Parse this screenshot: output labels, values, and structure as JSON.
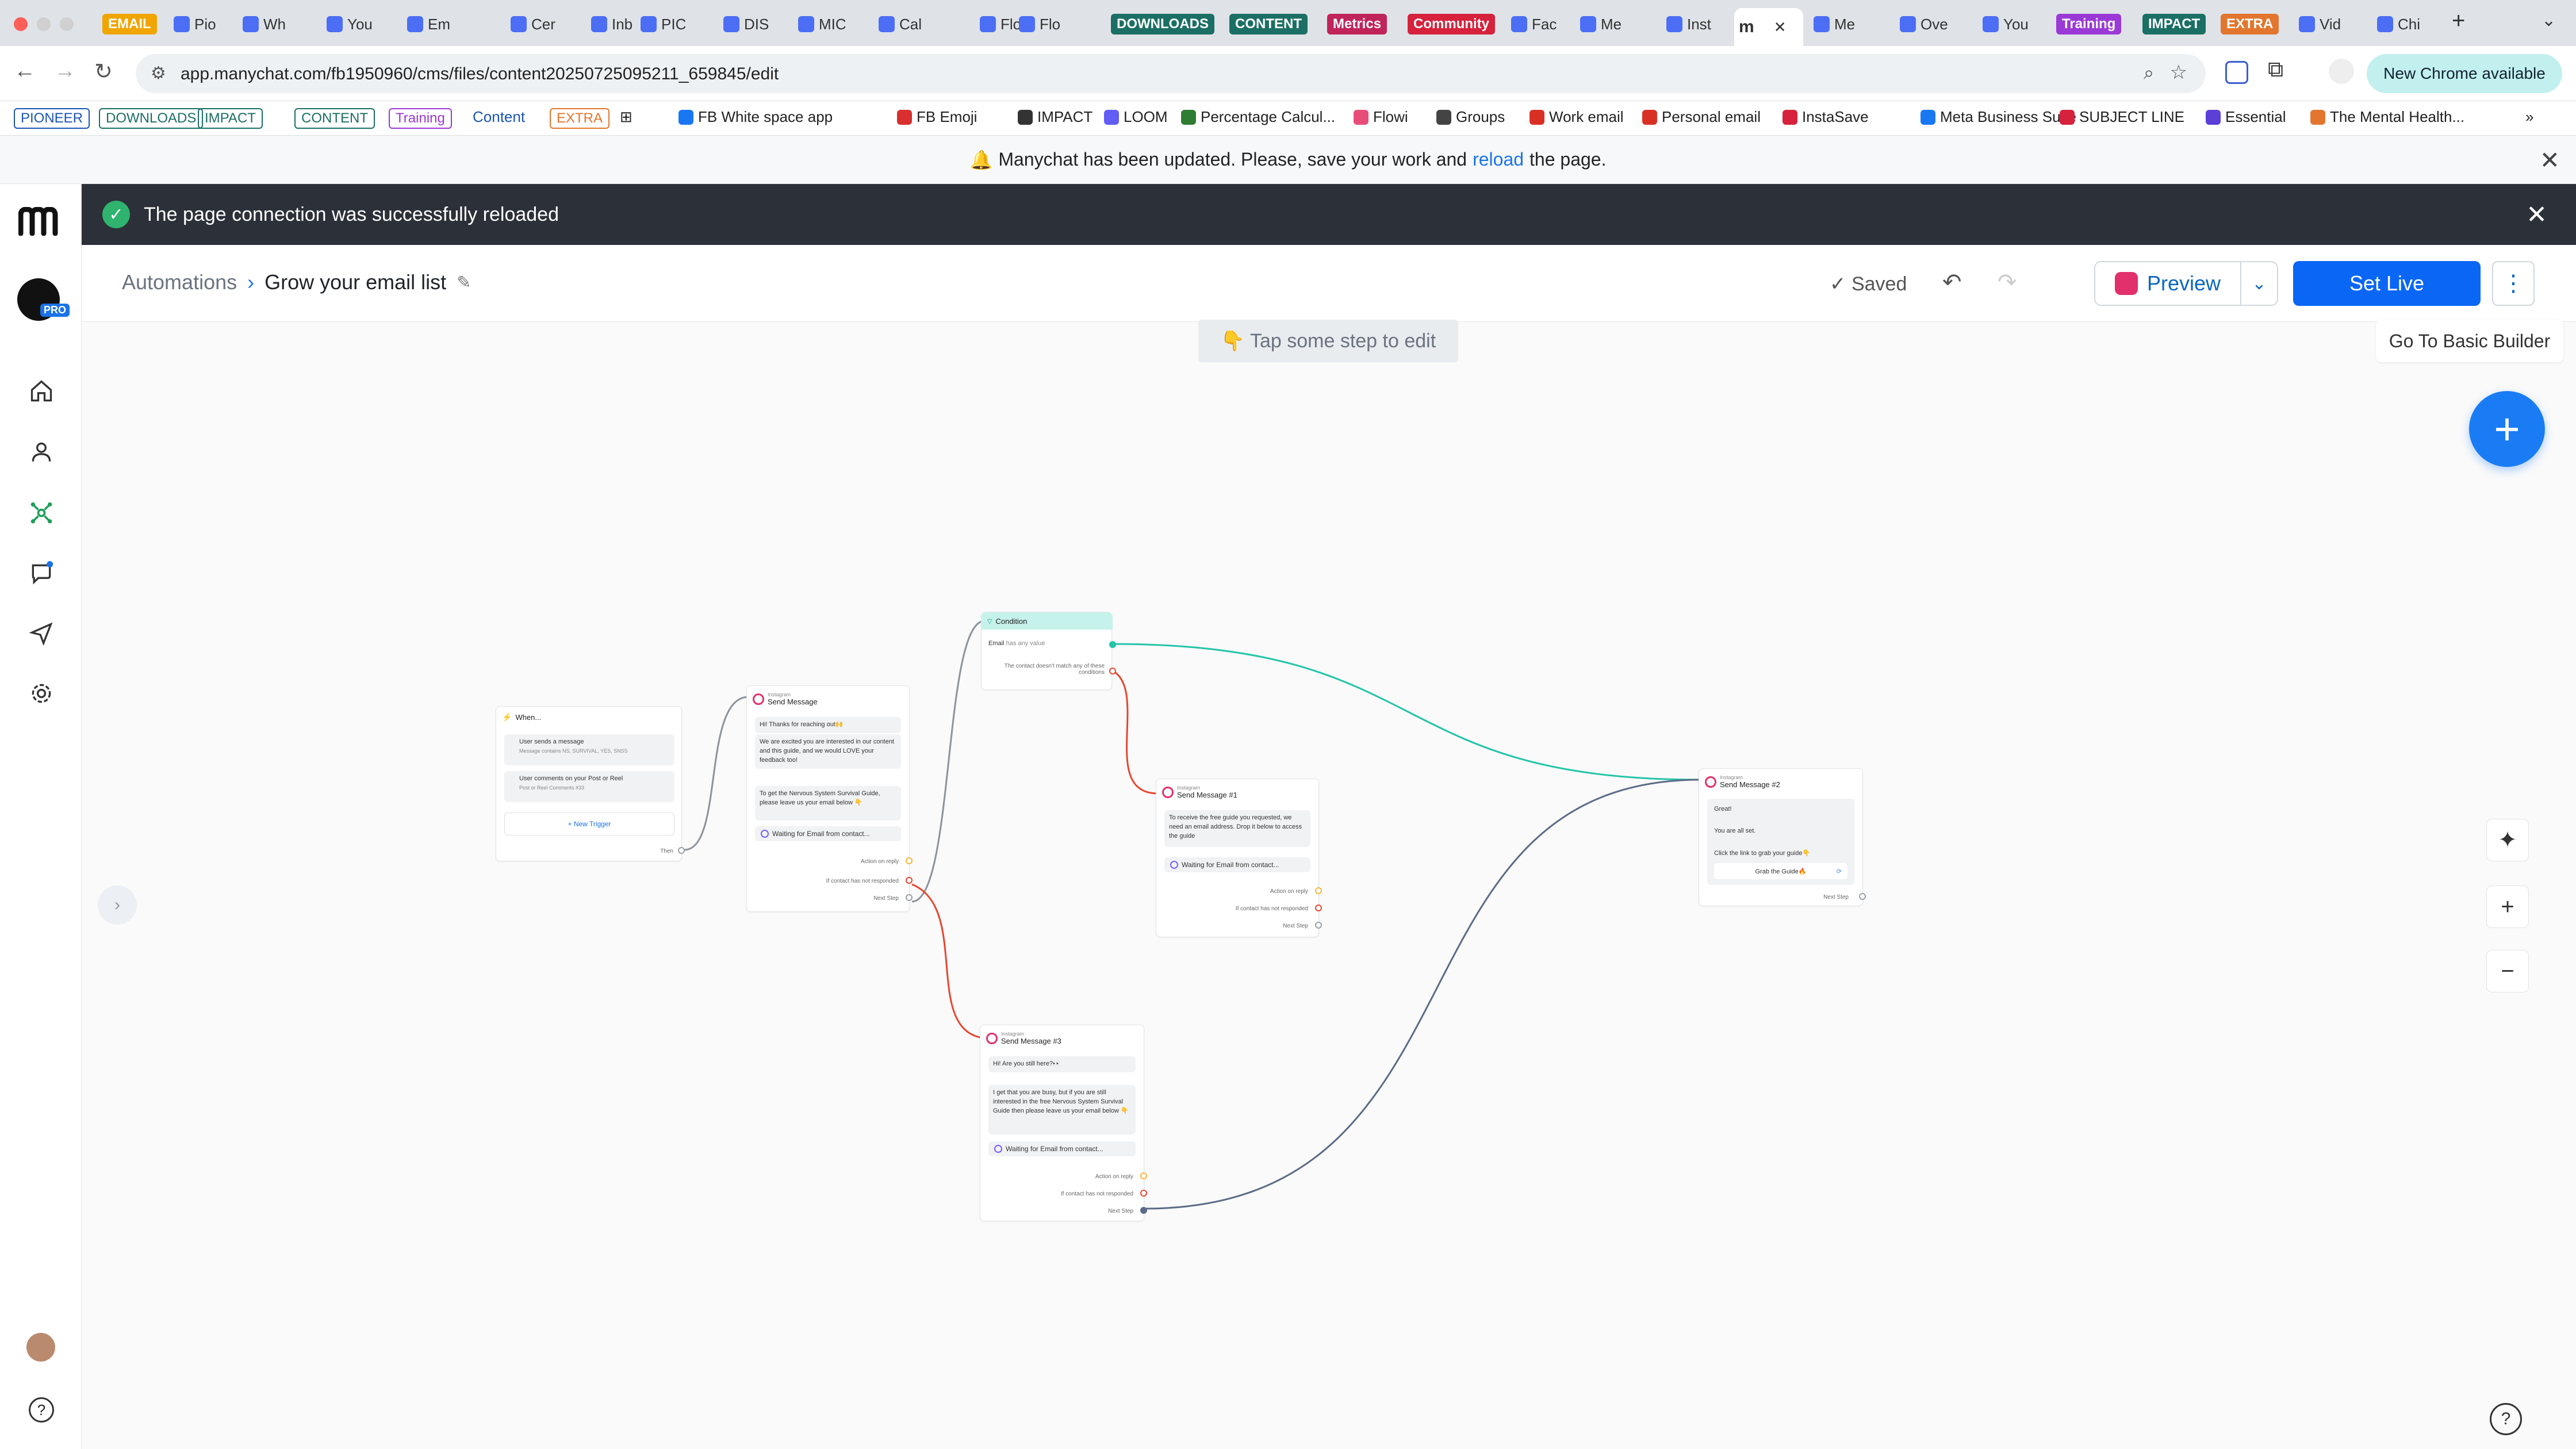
{
  "browser": {
    "tabs": [
      {
        "label": "EMAIL",
        "kind": "pill",
        "color": "#f0a500"
      },
      {
        "label": "Pio",
        "kind": "tab"
      },
      {
        "label": "Wh",
        "kind": "tab"
      },
      {
        "label": "You",
        "kind": "tab"
      },
      {
        "label": "Em",
        "kind": "tab"
      },
      {
        "label": "Cer",
        "kind": "tab"
      },
      {
        "label": "Inb",
        "kind": "tab"
      },
      {
        "label": "PIC",
        "kind": "tab"
      },
      {
        "label": "DIS",
        "kind": "tab"
      },
      {
        "label": "MIC",
        "kind": "tab"
      },
      {
        "label": "Cal",
        "kind": "tab"
      },
      {
        "label": "Flo",
        "kind": "tab"
      },
      {
        "label": "Flo",
        "kind": "tab"
      },
      {
        "label": "DOWNLOADS",
        "kind": "pill",
        "color": "#1b6f64"
      },
      {
        "label": "CONTENT",
        "kind": "pill",
        "color": "#1b6f64"
      },
      {
        "label": "Metrics",
        "kind": "pill",
        "color": "#c0245a"
      },
      {
        "label": "Community",
        "kind": "pill",
        "color": "#d6223c"
      },
      {
        "label": "Fac",
        "kind": "tab"
      },
      {
        "label": "Me",
        "kind": "tab"
      },
      {
        "label": "Inst",
        "kind": "tab"
      },
      {
        "label": "",
        "kind": "active"
      },
      {
        "label": "Me",
        "kind": "tab"
      },
      {
        "label": "Ove",
        "kind": "tab"
      },
      {
        "label": "You",
        "kind": "tab"
      },
      {
        "label": "Training",
        "kind": "pill",
        "color": "#9b39d6"
      },
      {
        "label": "IMPACT",
        "kind": "pill",
        "color": "#1b6f64"
      },
      {
        "label": "EXTRA",
        "kind": "pill",
        "color": "#e2762e"
      },
      {
        "label": "Vid",
        "kind": "tab"
      },
      {
        "label": "Chi",
        "kind": "tab"
      }
    ],
    "url": "app.manychat.com/fb1950960/cms/files/content20250725095211_659845/edit",
    "new_chrome": "New Chrome available",
    "bookmarks": [
      {
        "label": "PIONEER",
        "kind": "pill",
        "color": "#1a55b8"
      },
      {
        "label": "DOWNLOADS",
        "kind": "pill",
        "color": "#1b6f64"
      },
      {
        "label": "IMPACT",
        "kind": "pill",
        "color": "#1b6f64"
      },
      {
        "label": "CONTENT",
        "kind": "pill",
        "color": "#1b6f64"
      },
      {
        "label": "Training",
        "kind": "pill",
        "color": "#9b39d6"
      },
      {
        "label": "Content",
        "kind": "text",
        "color": "#1a55b8"
      },
      {
        "label": "EXTRA",
        "kind": "pill",
        "color": "#e2762e"
      },
      {
        "label": "FB White space app",
        "kind": "link",
        "color": "#1877f2"
      },
      {
        "label": "FB Emoji",
        "kind": "link",
        "color": "#d92f2f"
      },
      {
        "label": "IMPACT",
        "kind": "link",
        "color": "#333333"
      },
      {
        "label": "LOOM",
        "kind": "link",
        "color": "#625df5"
      },
      {
        "label": "Percentage Calcul...",
        "kind": "link",
        "color": "#2e7d32"
      },
      {
        "label": "Flowi",
        "kind": "link",
        "color": "#e84d7a"
      },
      {
        "label": "Groups",
        "kind": "link",
        "color": "#444444"
      },
      {
        "label": "Work email",
        "kind": "link",
        "color": "#d93025"
      },
      {
        "label": "Personal email",
        "kind": "link",
        "color": "#d93025"
      },
      {
        "label": "InstaSave",
        "kind": "link",
        "color": "#d6223c"
      },
      {
        "label": "Meta Business Suite",
        "kind": "link",
        "color": "#1877f2"
      },
      {
        "label": "SUBJECT LINE",
        "kind": "link",
        "color": "#d6223c"
      },
      {
        "label": "Essential",
        "kind": "link",
        "color": "#5b3fd6"
      },
      {
        "label": "The Mental Health...",
        "kind": "link",
        "color": "#e2762e"
      }
    ]
  },
  "update_banner": {
    "before": "Manychat has been updated. Please, save your work and",
    "link": "reload",
    "after": "the page."
  },
  "success_banner": "The page connection was successfully reloaded",
  "header": {
    "crumb_root": "Automations",
    "crumb_current": "Grow your email list",
    "saved": "Saved",
    "preview": "Preview",
    "set_live": "Set Live"
  },
  "canvas": {
    "tap_hint": "👇 Tap some step to edit",
    "basic_builder": "Go To Basic Builder"
  },
  "colors": {
    "brand_blue": "#0a66f5",
    "success_green": "#2fb36f",
    "edge_green": "#24c4a8",
    "edge_red": "#e8452f",
    "edge_blue": "#5b6b88",
    "edge_gray": "#8c939c",
    "instagram": "#e1306c"
  },
  "nodes": {
    "trigger": {
      "title": "When...",
      "trigger1": "User sends a message",
      "trigger1_sub": "Message contains NS, SURVIVAL, YES, SNSS",
      "trigger2": "User comments on your Post or Reel",
      "trigger2_sub": "Post or Reel Comments #33",
      "new_trigger": "+ New Trigger",
      "then": "Then"
    },
    "msg1": {
      "platform": "Instagram",
      "title": "Send Message",
      "b1": "Hi! Thanks for reaching out🙌",
      "b2": "We are excited you are interested in our content and this guide, and we would LOVE your feedback too!",
      "b3": "To get the Nervous System Survival Guide, please leave us your email below 👇",
      "waiting": "Waiting for Email from contact...",
      "action": "Action on reply",
      "notresp": "If contact has not responded",
      "next": "Next Step"
    },
    "condition": {
      "title": "Condition",
      "rule_field": "Email",
      "rule_op": "has any value",
      "else": "The contact doesn't match any of these conditions"
    },
    "msg_b": {
      "platform": "Instagram",
      "title": "Send Message #1",
      "b1": "To receive the free guide you requested, we need an email address. Drop it below to access the guide",
      "waiting": "Waiting for Email from contact...",
      "action": "Action on reply",
      "notresp": "If contact has not responded",
      "next": "Next Step"
    },
    "msg2": {
      "platform": "Instagram",
      "title": "Send Message #2",
      "b1": "Great!",
      "b2": "You are all set.",
      "b3": "Click the link to grab your guide👇",
      "btn": "Grab the Guide🔥",
      "next": "Next Step"
    },
    "msg3": {
      "platform": "Instagram",
      "title": "Send Message #3",
      "b1": "Hi! Are you still here?👀",
      "b2": "I get that you are busy, but if you are still interested in the free Nervous System Survival Guide then please leave us your email below 👇",
      "waiting": "Waiting for Email from contact...",
      "action": "Action on reply",
      "notresp": "If contact has not responded",
      "next": "Next Step"
    }
  },
  "icons": {
    "sidebar": [
      "home-icon",
      "contacts-icon",
      "automation-icon",
      "chat-icon",
      "broadcast-icon",
      "settings-icon"
    ],
    "header": [
      "pencil-icon",
      "check-icon",
      "undo-icon",
      "redo-icon",
      "instagram-icon",
      "chevron-down-icon",
      "kebab-icon"
    ]
  }
}
